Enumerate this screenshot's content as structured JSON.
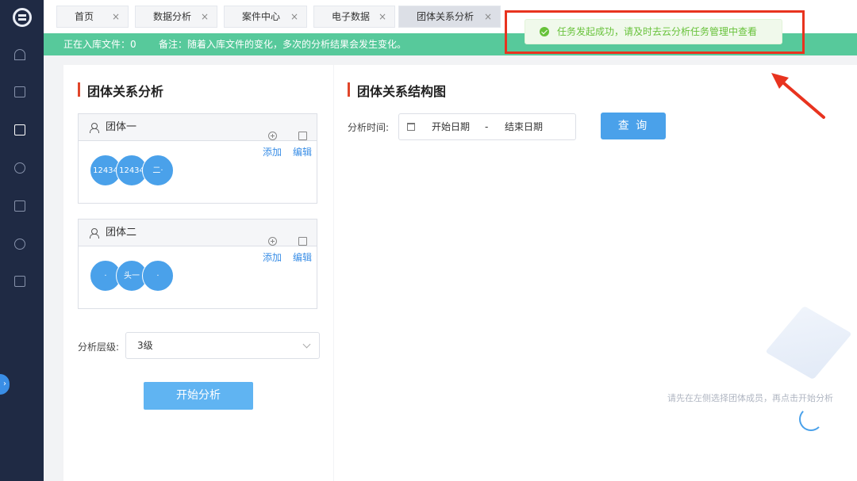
{
  "tabs": [
    {
      "label": "首页",
      "active": false
    },
    {
      "label": "数据分析",
      "active": false
    },
    {
      "label": "案件中心",
      "active": false
    },
    {
      "label": "电子数据",
      "active": false
    },
    {
      "label": "团体关系分析",
      "active": true
    }
  ],
  "tab_close_glyph": "×",
  "notice": {
    "importing": "正在入库文件：0",
    "remark": "备注：随着入库文件的变化，多次的分析结果会发生变化。"
  },
  "toast": {
    "message": "任务发起成功，请及时去云分析任务管理中查看",
    "icon": "success-check-icon"
  },
  "sidebar": {
    "icons": [
      "logo-icon",
      "home-icon",
      "chart-icon",
      "building-icon",
      "analysis-icon",
      "document-icon",
      "trend-icon",
      "report-icon"
    ],
    "collapse_glyph": "›"
  },
  "left_panel": {
    "title": "团体关系分析",
    "groups": [
      {
        "name": "团体一",
        "members": [
          "12434",
          "12434",
          "二·"
        ],
        "add_label": "添加",
        "edit_label": "编辑"
      },
      {
        "name": "团体二",
        "members": [
          "·",
          "头一",
          "·"
        ],
        "add_label": "添加",
        "edit_label": "编辑"
      }
    ],
    "level_label": "分析层级:",
    "level_value": "3级",
    "start_button": "开始分析"
  },
  "right_panel": {
    "title": "团体关系结构图",
    "time_label": "分析时间:",
    "start_placeholder": "开始日期",
    "range_separator": "-",
    "end_placeholder": "结束日期",
    "query_button": "查 询",
    "empty_text": "请先在左侧选择团体成员，再点击开始分析"
  },
  "colors": {
    "sidebar": "#1f2a44",
    "notice": "#57c99b",
    "primary": "#4aa1ea",
    "title_bar": "#e0462b",
    "annotation": "#e8331f",
    "toast_text": "#67c23a"
  }
}
